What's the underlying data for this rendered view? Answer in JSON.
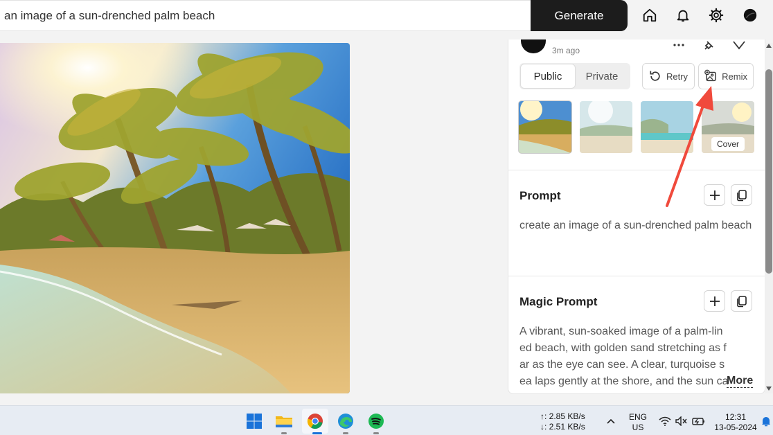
{
  "search": {
    "value": "an image of a sun-drenched palm beach",
    "generate_label": "Generate"
  },
  "top_icons": [
    "home-icon",
    "bell-icon",
    "gear-icon",
    "avatar"
  ],
  "panel": {
    "time_ago": "3m ago",
    "visibility": {
      "public_label": "Public",
      "private_label": "Private",
      "selected": "Public"
    },
    "retry_label": "Retry",
    "remix_label": "Remix",
    "cover_label": "Cover",
    "prompt": {
      "title": "Prompt",
      "text": "create an image of a sun-drenched palm beach"
    },
    "magic_prompt": {
      "title": "Magic Prompt",
      "text": "A vibrant, sun-soaked image of a palm-lined beach, with golden sand stretching as far as the eye can see. A clear, turquoise sea laps gently at the shore, and the sun casts a…",
      "more_label": "More"
    }
  },
  "taskbar": {
    "upload_speed": "↑: 2.85 KB/s",
    "download_speed": "↓: 2.51 KB/s",
    "lang_line1": "ENG",
    "lang_line2": "US",
    "time": "12:31",
    "date": "13-05-2024"
  },
  "colors": {
    "generate_bg": "#1c1c1c",
    "annotation_arrow": "#f04a3c"
  }
}
